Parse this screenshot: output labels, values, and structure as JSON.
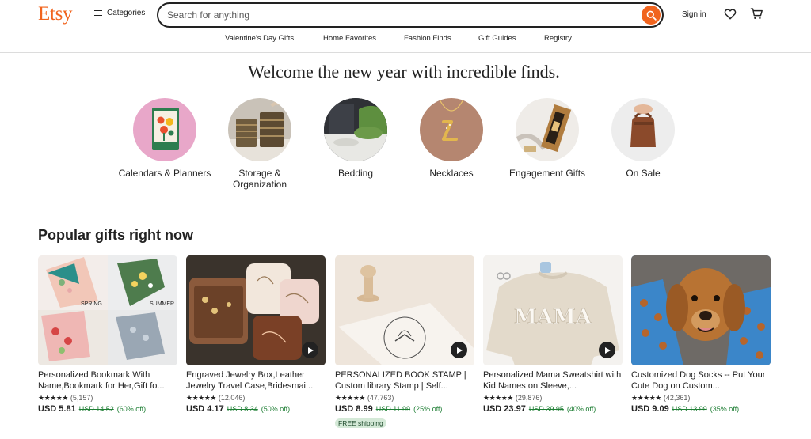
{
  "header": {
    "logo": "Etsy",
    "categories_label": "Categories",
    "search_placeholder": "Search for anything",
    "signin_label": "Sign in",
    "accent": "#F1641E"
  },
  "subnav": [
    "Valentine's Day Gifts",
    "Home Favorites",
    "Fashion Finds",
    "Gift Guides",
    "Registry"
  ],
  "hero": {
    "title": "Welcome the new year with incredible finds.",
    "categories": [
      {
        "label": "Calendars & Planners",
        "icon": "calendar-image"
      },
      {
        "label": "Storage & Organization",
        "icon": "baskets-image"
      },
      {
        "label": "Bedding",
        "icon": "bedding-image"
      },
      {
        "label": "Necklaces",
        "icon": "necklace-image"
      },
      {
        "label": "Engagement Gifts",
        "icon": "wine-box-image"
      },
      {
        "label": "On Sale",
        "icon": "leather-bag-image"
      }
    ]
  },
  "popular": {
    "title": "Popular gifts right now",
    "items": [
      {
        "title": "Personalized Bookmark With Name,Bookmark for Her,Gift fo...",
        "stars": "★★★★★",
        "reviews": "(5,157)",
        "price": "USD 5.81",
        "original": "USD 14.52",
        "discount": "(60% off)",
        "video": false,
        "season_labels": [
          "SPRING",
          "SUMMER"
        ]
      },
      {
        "title": "Engraved Jewelry Box,Leather Jewelry Travel Case,Bridesmai...",
        "stars": "★★★★★",
        "reviews": "(12,046)",
        "price": "USD 4.17",
        "original": "USD 8.34",
        "discount": "(50% off)",
        "video": true
      },
      {
        "title": "PERSONALIZED BOOK STAMP | Custom library Stamp | Self...",
        "stars": "★★★★★",
        "reviews": "(47,763)",
        "price": "USD 8.99",
        "original": "USD 11.99",
        "discount": "(25% off)",
        "video": true,
        "badge": "FREE shipping"
      },
      {
        "title": "Personalized Mama Sweatshirt with Kid Names on Sleeve,...",
        "stars": "★★★★★",
        "reviews": "(29,876)",
        "price": "USD 23.97",
        "original": "USD 39.95",
        "discount": "(40% off)",
        "video": true,
        "print": "MAMA"
      },
      {
        "title": "Customized Dog Socks -- Put Your Cute Dog on Custom...",
        "stars": "★★★★★",
        "reviews": "(42,361)",
        "price": "USD 9.09",
        "original": "USD 13.99",
        "discount": "(35% off)",
        "video": false
      }
    ]
  }
}
